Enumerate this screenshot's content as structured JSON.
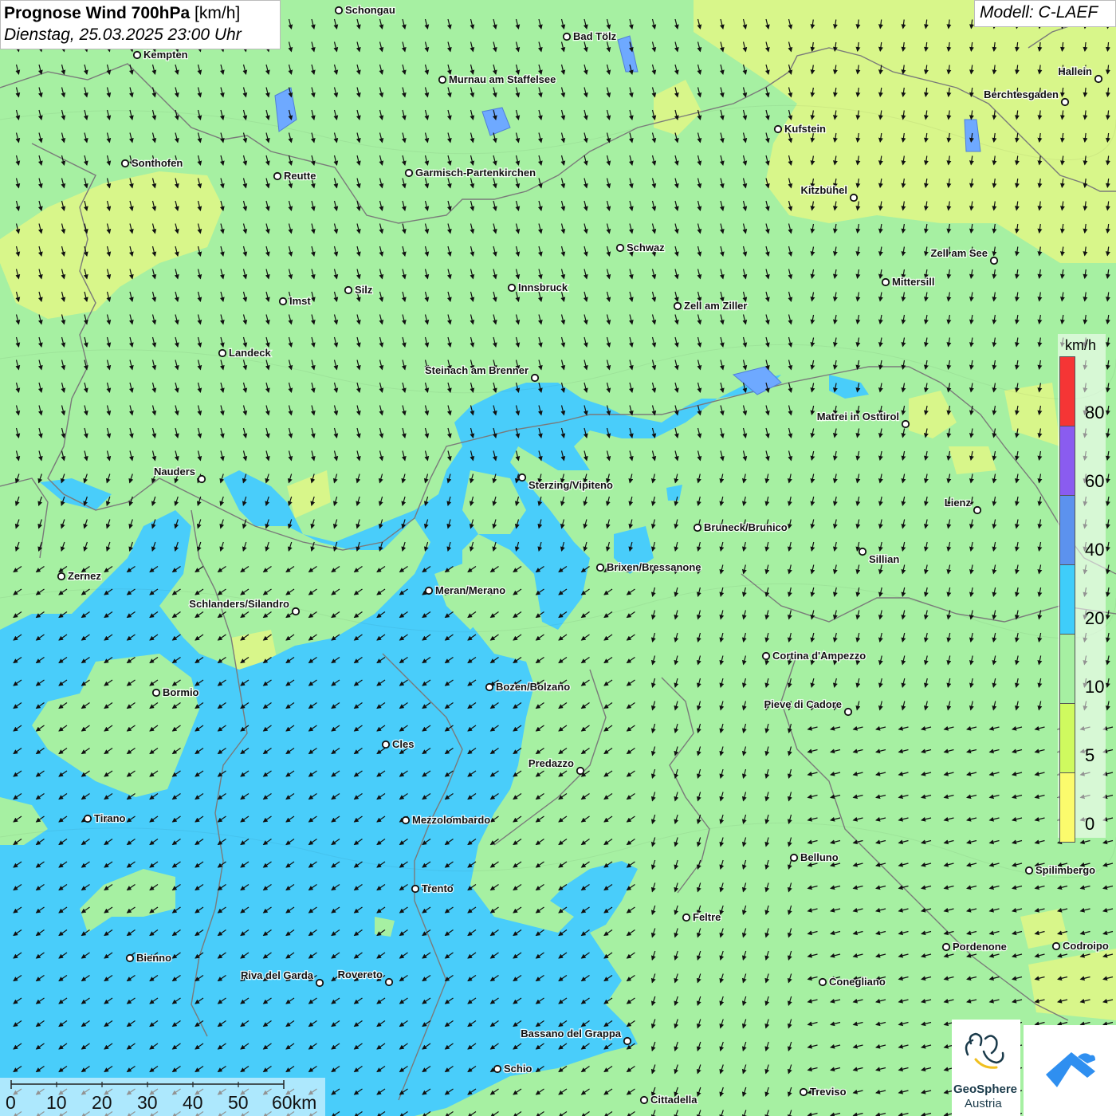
{
  "title": {
    "main": "Prognose Wind 700hPa",
    "unit": "[km/h]",
    "datetime": "Dienstag, 25.03.2025 23:00 Uhr"
  },
  "model": "Modell: C-LAEF",
  "legend": {
    "unit": "km/h",
    "labels": [
      "80",
      "60",
      "40",
      "20",
      "10",
      "5",
      "0"
    ],
    "colors": [
      "#f53535",
      "#8a5cf0",
      "#5c92ee",
      "#3fcdfa",
      "#a6f0a2",
      "#cffa5f",
      "#fbfb6d"
    ]
  },
  "scalebar": {
    "labels": [
      "0",
      "10",
      "20",
      "30",
      "40",
      "50",
      "60km"
    ]
  },
  "logo": {
    "line1": "GeoSphere",
    "line2": "Austria"
  },
  "cities": [
    {
      "name": "Schongau"
    },
    {
      "name": "Bad Tölz"
    },
    {
      "name": "Kempten"
    },
    {
      "name": "Murnau am Staffelsee"
    },
    {
      "name": "Hallein"
    },
    {
      "name": "Berchtesgaden"
    },
    {
      "name": "Kufstein"
    },
    {
      "name": "Sonthofen"
    },
    {
      "name": "Reutte"
    },
    {
      "name": "Garmisch-Partenkirchen"
    },
    {
      "name": "Kitzbühel"
    },
    {
      "name": "Schwaz"
    },
    {
      "name": "Zell am See"
    },
    {
      "name": "Mittersill"
    },
    {
      "name": "Innsbruck"
    },
    {
      "name": "Silz"
    },
    {
      "name": "Imst"
    },
    {
      "name": "Zell am Ziller"
    },
    {
      "name": "Landeck"
    },
    {
      "name": "Steinach am Brenner"
    },
    {
      "name": "Matrei in Osttirol"
    },
    {
      "name": "Nauders"
    },
    {
      "name": "Sterzing/Vipiteno"
    },
    {
      "name": "Lienz"
    },
    {
      "name": "Bruneck/Brunico"
    },
    {
      "name": "Sillian"
    },
    {
      "name": "Zernez"
    },
    {
      "name": "Brixen/Bressanone"
    },
    {
      "name": "Meran/Merano"
    },
    {
      "name": "Schlanders/Silandro"
    },
    {
      "name": "Cortina d'Ampezzo"
    },
    {
      "name": "Bozen/Bolzano"
    },
    {
      "name": "Bormio"
    },
    {
      "name": "Pieve di Cadore"
    },
    {
      "name": "Cles"
    },
    {
      "name": "Predazzo"
    },
    {
      "name": "Tirano"
    },
    {
      "name": "Mezzolombardo"
    },
    {
      "name": "Belluno"
    },
    {
      "name": "Spilimbergo"
    },
    {
      "name": "Trento"
    },
    {
      "name": "Feltre"
    },
    {
      "name": "Pordenone"
    },
    {
      "name": "Codroipo"
    },
    {
      "name": "Bienno"
    },
    {
      "name": "Riva del Garda"
    },
    {
      "name": "Rovereto"
    },
    {
      "name": "Conegliano"
    },
    {
      "name": "Bassano del Grappa"
    },
    {
      "name": "Schio"
    },
    {
      "name": "Treviso"
    },
    {
      "name": "Cittadella"
    }
  ]
}
